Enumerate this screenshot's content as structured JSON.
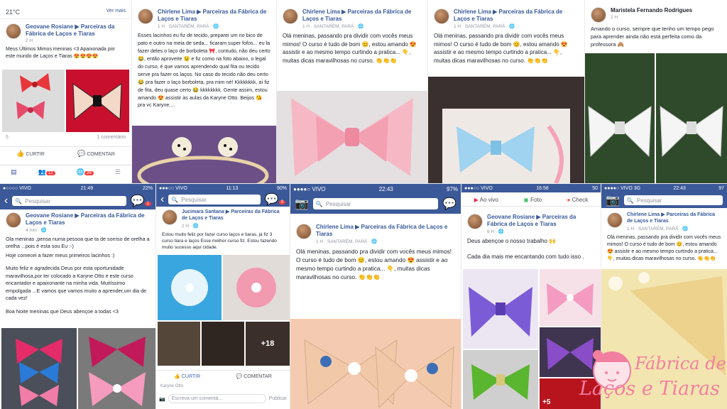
{
  "t1": {
    "weather_temp": "21°C",
    "see_more": "Ver mais",
    "author": "Geovane Rosiane ▶ Parceiras da Fábrica de Laços e Tiaras",
    "time": "2 H",
    "text": "Meus Últimos Mimos meninas <3 Apaixonada por este mundo de Laços e Tiaras 😍😍😍😍",
    "reactions": "5",
    "comments": "1 comentário",
    "like": "CURTIR",
    "comment": "COMENTAR",
    "badge1": "12",
    "badge2": "26"
  },
  "t2": {
    "author": "Chirlene Lima ▶ Parceiras da Fábrica de Laços e Tiaras",
    "time": "1 H · SANTARÉM, PARÁ · 🌐",
    "text": "Esses lacinhos eu fiz de tecido, preparei um no bico de pato e outro na meia de seda... ficaram super fofos... eu la fazer deles o laço de borboleta 🎀, contudo, não deu certo😂, então aproveite 😉 e fiz como na foto abaixo, o legal do curso, é que vamos aprendendo qual fita ou tecido serve pra fazer os laços. No caso do tecido não deu certo 😂 pra fazer o laço borboleta, pra mim né! Kkkkkkkk, aí fiz de fita, deu quase certo 😂 kkkkkkkk. Gente assim, estou amando 😍 assistir às aulas da Karyne Otto. Beijos 😘 pra vc Karyne...."
  },
  "t3": {
    "author": "Chirlene Lima ▶ Parceiras da Fábrica de Laços e Tiaras",
    "time": "1 H · SANTARÉM, PARÁ · 🌐",
    "text": "Olá meninas, passando pra dividir com vocês meus mimos! O curso é tudo de bom 😊, estou amando 😍 assistir e ao mesmo tempo curtindo a pratica... 👇, muitas dicas maravilhosas no curso. 👏👏👏"
  },
  "t4": {
    "author": "Chirlene Lima ▶ Parceiras da Fábrica de Laços e Tiaras",
    "time": "1 H · SANTARÉM, PARÁ · 🌐",
    "text": "Olá meninas, passando pra dividir com vocês meus mimos! O curso é tudo de bom 😊, estou amando 😍 assistir e ao mesmo tempo curtindo a pratica... 👇, muitas dicas maravilhosas no curso. 👏👏👏"
  },
  "t5": {
    "author": "Maristela Fernando Rodrigues",
    "time": "2 H",
    "text": "Amando o curso, sempre que tenho um tempo pego para aprender ainda não está perfeita como da professora 🙈"
  },
  "t6": {
    "carrier": "●○○○○ VIVO",
    "clock": "21:49",
    "battery": "22%",
    "search": "Pesquisar",
    "msg_badge": "1",
    "author": "Geovane Rosiane ▶ Parceiras da Fábrica de Laços e Tiaras",
    "time": "4 min · 🌐",
    "text1": "Ola meninas ,pensa numa pessoa que ta de sorriso de orelha a orelha ...pois é esta sou Eu :-)",
    "text2": " Hoje comecei a fazer meus primeiros lacinhos :)",
    "text3": "Muito feliz e agradecida Deus por esta oportunidade maravilhosa,por ter colocado a Karyne Otto e este curso encantador e apaixonante na minha vida. Muitíssimo empolgada ...E vamos que vamos muito a aprender,um dia de cada vez!",
    "text4": "Boa Noite meninas que Deus abençoe a todas <3"
  },
  "t7": {
    "carrier": "●●●○○ VIVO",
    "clock": "11:13",
    "battery": "90%",
    "search": "Pesquisar",
    "msg_badge": "9",
    "author": "Jucimara Santana ▶ Parceiras da Fábrica de Laços e Tiaras",
    "time": "2 H · 🌐",
    "text": "Estou muito feliz por fazer  curso laços e tiaras. já fiz 3 curso tiara e laços  Esse melhor curso fiz.  Estou fazendo muito sucesso aqui cidade.",
    "more": "+18",
    "like": "CURTIR",
    "comment": "COMENTAR",
    "comment_ph": "Escreva um comentá...",
    "publish": "Publicar",
    "next_author": "Karyne Otto"
  },
  "t8": {
    "carrier": "●●●●○ VIVO",
    "clock": "22:43",
    "battery": "97%",
    "search": "Pesquisar",
    "author": "Chirlene Lima ▶ Parceiras da Fábrica de Laços e Tiaras",
    "time": "1 H · SANTARÉM, PARÁ · 🌐",
    "text": "Olá meninas, passando pra dividir com vocês meus mimos! O curso é tudo de bom 😊, estou amando 😍 assistir e ao mesmo tempo curtindo a pratica... 👇, muitas dicas maravilhosas no curso. 👏👏👏"
  },
  "t9": {
    "carrier": "●●●○○ VIVO",
    "clock": "16:58",
    "battery": "50",
    "live": "Ao vivo",
    "photo": "Foto",
    "checkin": "Check",
    "author": "Geovane Rosiane ▶ Parceiras da Fábrica de Laços e Tiaras",
    "time": "6 H · 🌐",
    "text1": "Deus abençoe o nosso trabalho 🙌",
    "text2": "Cada dia mais me encantando com tudo isso .",
    "more": "+5"
  },
  "t10": {
    "carrier": "●●●●○ VIVO",
    "net": "3G",
    "clock": "22:43",
    "battery": "97",
    "search": "Pesquisar",
    "author": "Chirlene Lima ▶ Parceiras da Fábrica de Laços e Tiaras",
    "time": "1 H · SANTARÉM, PARÁ · 🌐",
    "text": "Olá meninas, passando pra dividir com vocês meus mimos! O curso é tudo de bom 😊, estou amando 😍 assistir e ao mesmo tempo curtindo a pratica... 👇, muitas dicas maravilhosas no curso. 👏👏👏"
  },
  "logo": {
    "line1": "Fábrica de",
    "line2": "Laços e Tiaras"
  },
  "colors": {
    "fb_blue": "#3b5998",
    "link": "#365899",
    "pink": "#f27fa0"
  }
}
